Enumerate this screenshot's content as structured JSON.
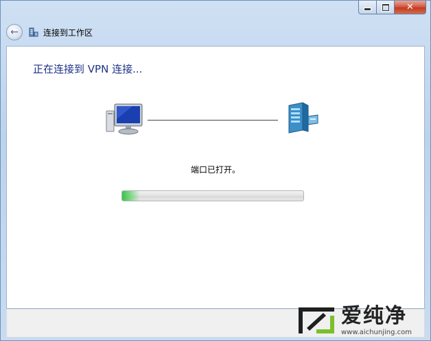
{
  "window": {
    "title": "连接到工作区",
    "controls": {
      "minimize_icon": "minimize-icon",
      "maximize_icon": "maximize-icon",
      "close_icon": "close-icon",
      "close_glyph": "✕"
    }
  },
  "nav": {
    "back_icon": "back-arrow-icon",
    "back_glyph": "←",
    "title": "连接到工作区"
  },
  "main": {
    "heading": "正在连接到 VPN 连接...",
    "status": "端口已打开。",
    "progress": 0.1
  },
  "watermark": {
    "title": "爱纯净",
    "url": "www.aichunjing.com"
  },
  "colors": {
    "heading": "#1e3287",
    "progress_fill": "#32be46"
  }
}
